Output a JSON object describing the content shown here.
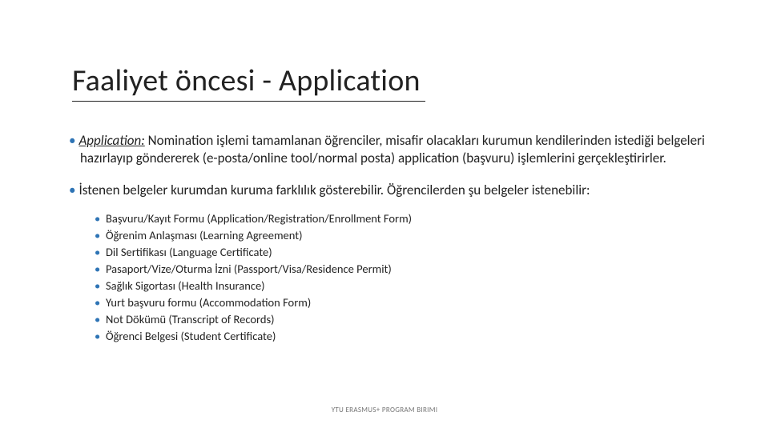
{
  "title": "Faaliyet öncesi - Application",
  "paragraph1": {
    "label": "Application:",
    "text": " Nomination işlemi tamamlanan öğrenciler, misafir olacakları kurumun kendilerinden istediği belgeleri hazırlayıp göndererek (e-posta/online tool/normal posta) application (başvuru) işlemlerini gerçekleştirirler."
  },
  "paragraph2": "İstenen belgeler kurumdan kuruma farklılık gösterebilir. Öğrencilerden şu belgeler istenebilir:",
  "documents": [
    "Başvuru/Kayıt Formu (Application/Registration/Enrollment Form)",
    "Öğrenim Anlaşması (Learning Agreement)",
    "Dil Sertifikası (Language Certificate)",
    "Pasaport/Vize/Oturma İzni (Passport/Visa/Residence Permit)",
    "Sağlık Sigortası (Health Insurance)",
    "Yurt başvuru formu (Accommodation Form)",
    "Not Dökümü (Transcript of Records)",
    "Öğrenci Belgesi (Student Certificate)"
  ],
  "footer": "YTU ERASMUS+ PROGRAM BIRIMI"
}
